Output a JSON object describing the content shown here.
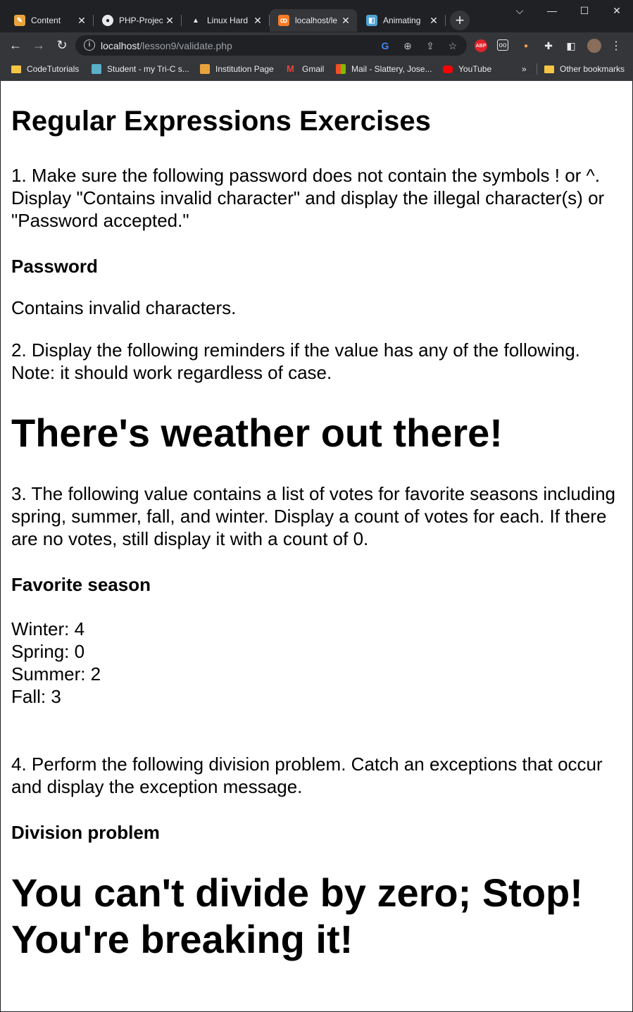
{
  "tabs": [
    {
      "label": "Content",
      "icon": "pencil-icon",
      "color": "#e8a33d",
      "active": false
    },
    {
      "label": "PHP-Projec",
      "icon": "github-icon",
      "color": "#202124",
      "active": false
    },
    {
      "label": "Linux Hard",
      "icon": "penguin-icon",
      "color": "#202124",
      "active": false
    },
    {
      "label": "localhost/le",
      "icon": "xampp-icon",
      "color": "#fb7a24",
      "active": true
    },
    {
      "label": "Animating",
      "icon": "animation-icon",
      "color": "#4da3d4",
      "active": false
    }
  ],
  "address": {
    "host": "localhost",
    "path": "/lesson9/validate.php"
  },
  "bookmarks": [
    {
      "label": "CodeTutorials",
      "type": "folder"
    },
    {
      "label": "Student - my Tri-C s...",
      "type": "site",
      "color": "#5ab0c9"
    },
    {
      "label": "Institution Page",
      "type": "site",
      "color": "#e8a33d"
    },
    {
      "label": "Gmail",
      "type": "site",
      "color": "#ea4335"
    },
    {
      "label": "Mail - Slattery, Jose...",
      "type": "site",
      "color": "#0078d4"
    },
    {
      "label": "YouTube",
      "type": "site",
      "color": "#ff0000"
    },
    {
      "label": "»",
      "type": "overflow"
    },
    {
      "label": "Other bookmarks",
      "type": "folder"
    }
  ],
  "page": {
    "title": "Regular Expressions Exercises",
    "q1": "1. Make sure the following password does not contain the symbols ! or ^. Display \"Contains invalid character\" and display the illegal character(s) or \"Password accepted.\"",
    "q1_heading": "Password",
    "q1_result": "Contains invalid characters.",
    "q2": "2. Display the following reminders if the value has any of the following. Note: it should work regardless of case.",
    "q2_result": "There's weather out there!",
    "q3": "3. The following value contains a list of votes for favorite seasons including spring, summer, fall, and winter. Display a count of votes for each. If there are no votes, still display it with a count of 0.",
    "q3_heading": "Favorite season",
    "seasons": [
      "Winter: 4",
      "Spring: 0",
      "Summer: 2",
      "Fall: 3"
    ],
    "q4": "4. Perform the following division problem. Catch an exceptions that occur and display the exception message.",
    "q4_heading": "Division problem",
    "q4_result": "You can't divide by zero; Stop! You're breaking it!"
  }
}
